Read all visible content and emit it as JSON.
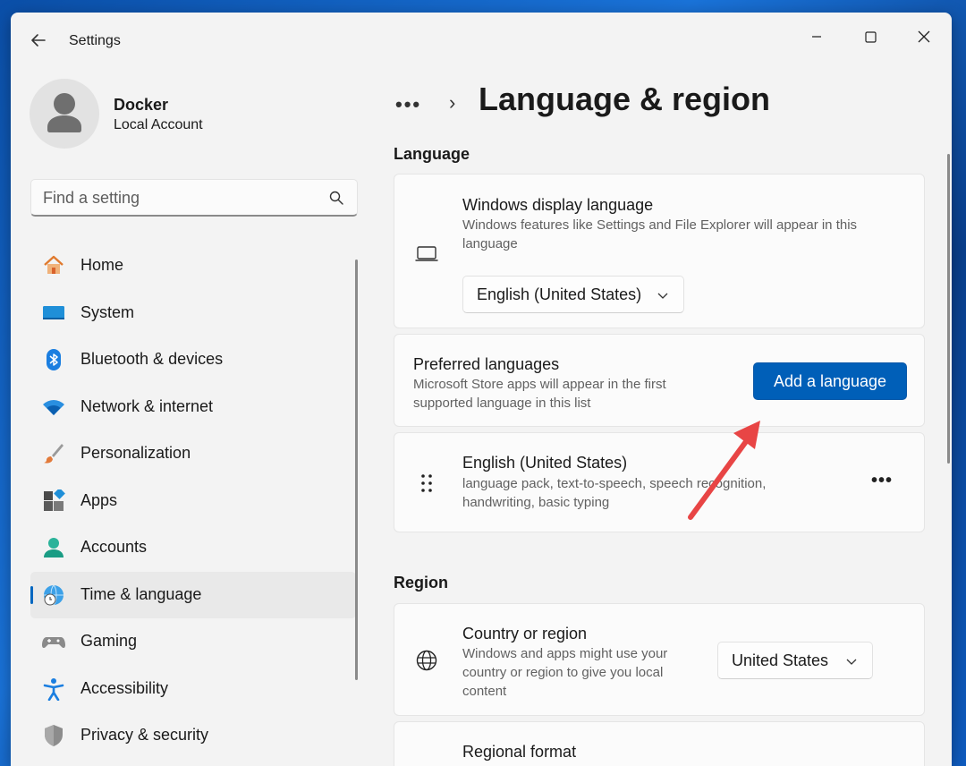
{
  "window": {
    "title": "Settings"
  },
  "user": {
    "name": "Docker",
    "account_type": "Local Account"
  },
  "search": {
    "placeholder": "Find a setting"
  },
  "nav": {
    "items": [
      {
        "label": "Home"
      },
      {
        "label": "System"
      },
      {
        "label": "Bluetooth & devices"
      },
      {
        "label": "Network & internet"
      },
      {
        "label": "Personalization"
      },
      {
        "label": "Apps"
      },
      {
        "label": "Accounts"
      },
      {
        "label": "Time & language"
      },
      {
        "label": "Gaming"
      },
      {
        "label": "Accessibility"
      },
      {
        "label": "Privacy & security"
      }
    ],
    "active": "Time & language"
  },
  "breadcrumb": {
    "overflow": "•••",
    "separator": "›"
  },
  "page": {
    "title": "Language & region"
  },
  "language_section": {
    "title": "Language",
    "display_language": {
      "title": "Windows display language",
      "description": "Windows features like Settings and File Explorer will appear in this language",
      "selected": "English (United States)"
    },
    "preferred": {
      "title": "Preferred languages",
      "description": "Microsoft Store apps will appear in the first supported language in this list",
      "add_button": "Add a language"
    },
    "installed": {
      "title": "English (United States)",
      "description": "language pack, text-to-speech, speech recognition, handwriting, basic typing",
      "more": "•••"
    }
  },
  "region_section": {
    "title": "Region",
    "country": {
      "title": "Country or region",
      "description": "Windows and apps might use your country or region to give you local content",
      "selected": "United States"
    },
    "format": {
      "title": "Regional format"
    }
  },
  "colors": {
    "accent": "#005fb8",
    "annotation_arrow": "#e84545"
  }
}
